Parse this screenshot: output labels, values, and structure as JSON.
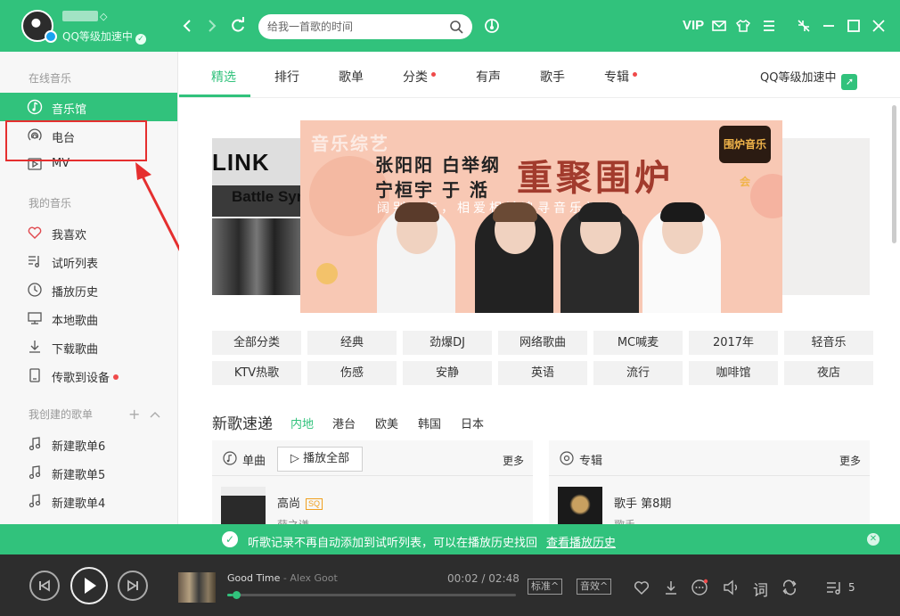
{
  "user": {
    "status": "QQ等级加速中"
  },
  "search": {
    "placeholder": "给我一首歌的时间"
  },
  "titlebar": {
    "vip": "VIP"
  },
  "sidebar": {
    "online_title": "在线音乐",
    "online_items": [
      {
        "label": "音乐馆",
        "icon": "music-hall-icon",
        "active": true
      },
      {
        "label": "电台",
        "icon": "radio-icon"
      },
      {
        "label": "MV",
        "icon": "mv-icon"
      }
    ],
    "my_title": "我的音乐",
    "my_items": [
      {
        "label": "我喜欢",
        "icon": "heart-icon"
      },
      {
        "label": "试听列表",
        "icon": "listen-list-icon"
      },
      {
        "label": "播放历史",
        "icon": "history-icon"
      },
      {
        "label": "本地歌曲",
        "icon": "local-icon"
      },
      {
        "label": "下载歌曲",
        "icon": "download-icon"
      },
      {
        "label": "传歌到设备",
        "icon": "device-icon",
        "dot": true
      }
    ],
    "created_title": "我创建的歌单",
    "created_items": [
      {
        "label": "新建歌单6",
        "icon": "playlist-icon"
      },
      {
        "label": "新建歌单5",
        "icon": "playlist-icon"
      },
      {
        "label": "新建歌单4",
        "icon": "playlist-icon"
      }
    ]
  },
  "tabs": [
    {
      "label": "精选",
      "active": true
    },
    {
      "label": "排行"
    },
    {
      "label": "歌单"
    },
    {
      "label": "分类",
      "dot": true
    },
    {
      "label": "有声"
    },
    {
      "label": "歌手"
    },
    {
      "label": "专辑",
      "dot": true
    }
  ],
  "vip_speed": "QQ等级加速中",
  "banner": {
    "watermark": "音乐综艺",
    "names_line1": "张阳阳 白举纲",
    "names_line2": "宁桓宇 于  湉",
    "headline": "重聚围炉",
    "tagline": "阔别三年，相爱相杀追寻音乐初心",
    "logo": "围炉音乐会",
    "left_poster_band": "LINK",
    "left_poster_sub": "Battle Syn"
  },
  "categories": [
    [
      "全部分类",
      "经典",
      "劲爆DJ",
      "网络歌曲",
      "MC喊麦",
      "2017年",
      "轻音乐"
    ],
    [
      "KTV热歌",
      "伤感",
      "安静",
      "英语",
      "流行",
      "咖啡馆",
      "夜店"
    ]
  ],
  "new_songs": {
    "title": "新歌速递",
    "tabs": [
      {
        "label": "内地",
        "active": true
      },
      {
        "label": "港台"
      },
      {
        "label": "欧美"
      },
      {
        "label": "韩国"
      },
      {
        "label": "日本"
      }
    ],
    "single": {
      "label": "单曲",
      "play_all": "播放全部",
      "more": "更多",
      "song": "高尚",
      "badge": "SQ",
      "artist": "薛之谦"
    },
    "album": {
      "label": "专辑",
      "more": "更多",
      "name": "歌手 第8期",
      "artist": "歌手"
    }
  },
  "notice": {
    "text": "听歌记录不再自动添加到试听列表，可以在播放历史找回",
    "link": "查看播放历史"
  },
  "player": {
    "title": "Good Time",
    "artist": "Alex Goot",
    "separator": " - ",
    "time": "00:02 / 02:48",
    "progress": 0.02,
    "quality": "标准",
    "effect": "音效",
    "lyric": "词",
    "playlist_count": "5"
  },
  "colors": {
    "brand": "#31c27c",
    "alert": "#e52f2f"
  }
}
